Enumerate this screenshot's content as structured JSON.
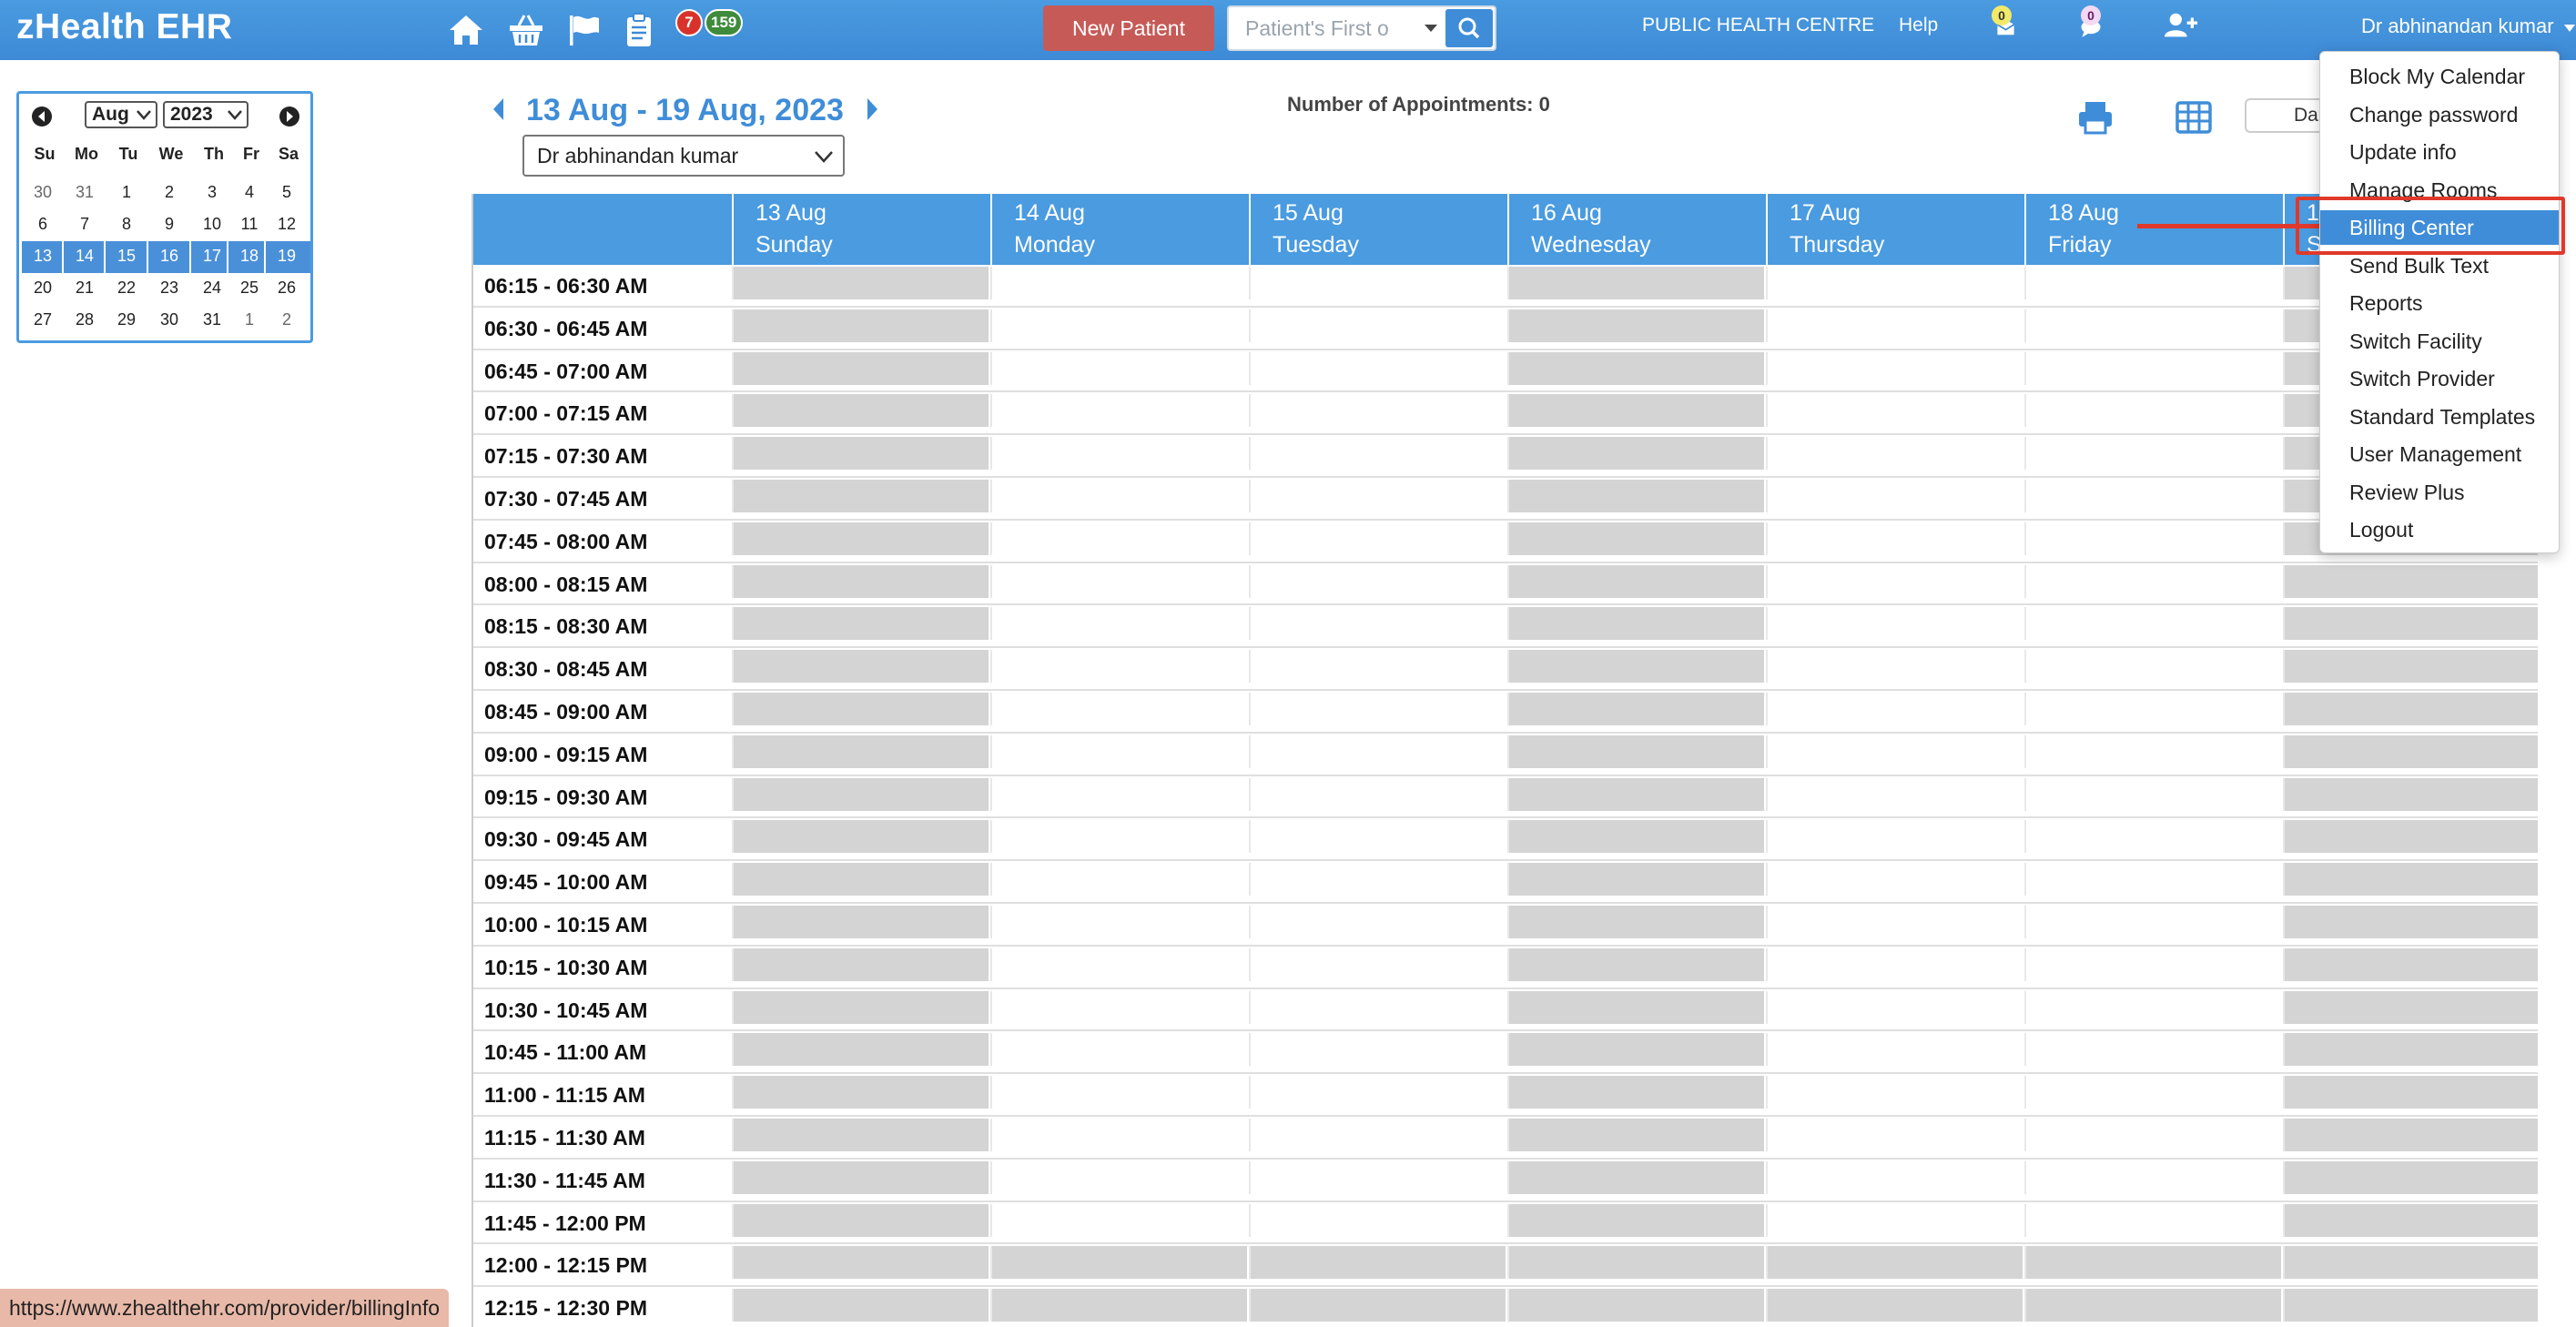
{
  "app": {
    "brand": "zHealth EHR",
    "facility": "PUBLIC HEALTH CENTRE",
    "help_label": "Help",
    "user_name": "Dr abhinandan kumar",
    "new_patient_label": "New Patient",
    "search_placeholder": "Patient's First o",
    "badges": {
      "tasks_red": "7",
      "tasks_green": "159",
      "mail": "0",
      "chat": "0"
    },
    "nav_icons": [
      "home-icon",
      "basket-icon",
      "flag-icon",
      "clipboard-icon"
    ],
    "colors": {
      "primary": "#4a9be0",
      "accent_red": "#c65a57",
      "highlight": "#e0392b",
      "blocked": "#d4d4d4"
    }
  },
  "mini_calendar": {
    "month": "Aug",
    "year": "2023",
    "weekdays": [
      "Su",
      "Mo",
      "Tu",
      "We",
      "Th",
      "Fr",
      "Sa"
    ],
    "weeks": [
      [
        "30",
        "31",
        "1",
        "2",
        "3",
        "4",
        "5"
      ],
      [
        "6",
        "7",
        "8",
        "9",
        "10",
        "11",
        "12"
      ],
      [
        "13",
        "14",
        "15",
        "16",
        "17",
        "18",
        "19"
      ],
      [
        "20",
        "21",
        "22",
        "23",
        "24",
        "25",
        "26"
      ],
      [
        "27",
        "28",
        "29",
        "30",
        "31",
        "1",
        "2"
      ]
    ],
    "selected_week_index": 2
  },
  "schedule": {
    "range_title": "13 Aug - 19 Aug, 2023",
    "appointments_label": "Number of Appointments: 0",
    "provider": "Dr abhinandan kumar",
    "view_button_label": "Da",
    "days": [
      {
        "date": "13 Aug",
        "weekday": "Sunday"
      },
      {
        "date": "14 Aug",
        "weekday": "Monday"
      },
      {
        "date": "15 Aug",
        "weekday": "Tuesday"
      },
      {
        "date": "16 Aug",
        "weekday": "Wednesday"
      },
      {
        "date": "17 Aug",
        "weekday": "Thursday"
      },
      {
        "date": "18 Aug",
        "weekday": "Friday"
      },
      {
        "date": "19",
        "weekday": "Sa"
      }
    ],
    "time_slots": [
      "06:15 - 06:30 AM",
      "06:30 - 06:45 AM",
      "06:45 - 07:00 AM",
      "07:00 - 07:15 AM",
      "07:15 - 07:30 AM",
      "07:30 - 07:45 AM",
      "07:45 - 08:00 AM",
      "08:00 - 08:15 AM",
      "08:15 - 08:30 AM",
      "08:30 - 08:45 AM",
      "08:45 - 09:00 AM",
      "09:00 - 09:15 AM",
      "09:15 - 09:30 AM",
      "09:30 - 09:45 AM",
      "09:45 - 10:00 AM",
      "10:00 - 10:15 AM",
      "10:15 - 10:30 AM",
      "10:30 - 10:45 AM",
      "10:45 - 11:00 AM",
      "11:00 - 11:15 AM",
      "11:15 - 11:30 AM",
      "11:30 - 11:45 AM",
      "11:45 - 12:00 PM",
      "12:00 - 12:15 PM",
      "12:15 - 12:30 PM"
    ],
    "blocked_days_morning": [
      0,
      3,
      6
    ],
    "fully_blocked_from_slot": 23
  },
  "user_menu": {
    "items": [
      "Block My Calendar",
      "Change password",
      "Update info",
      "Manage Rooms",
      "Billing Center",
      "Send Bulk Text",
      "Reports",
      "Switch Facility",
      "Switch Provider",
      "Standard Templates",
      "User Management",
      "Review Plus",
      "Logout"
    ],
    "active_index": 4
  },
  "status_bar": {
    "url": "https://www.zhealthehr.com/provider/billingInfo"
  }
}
